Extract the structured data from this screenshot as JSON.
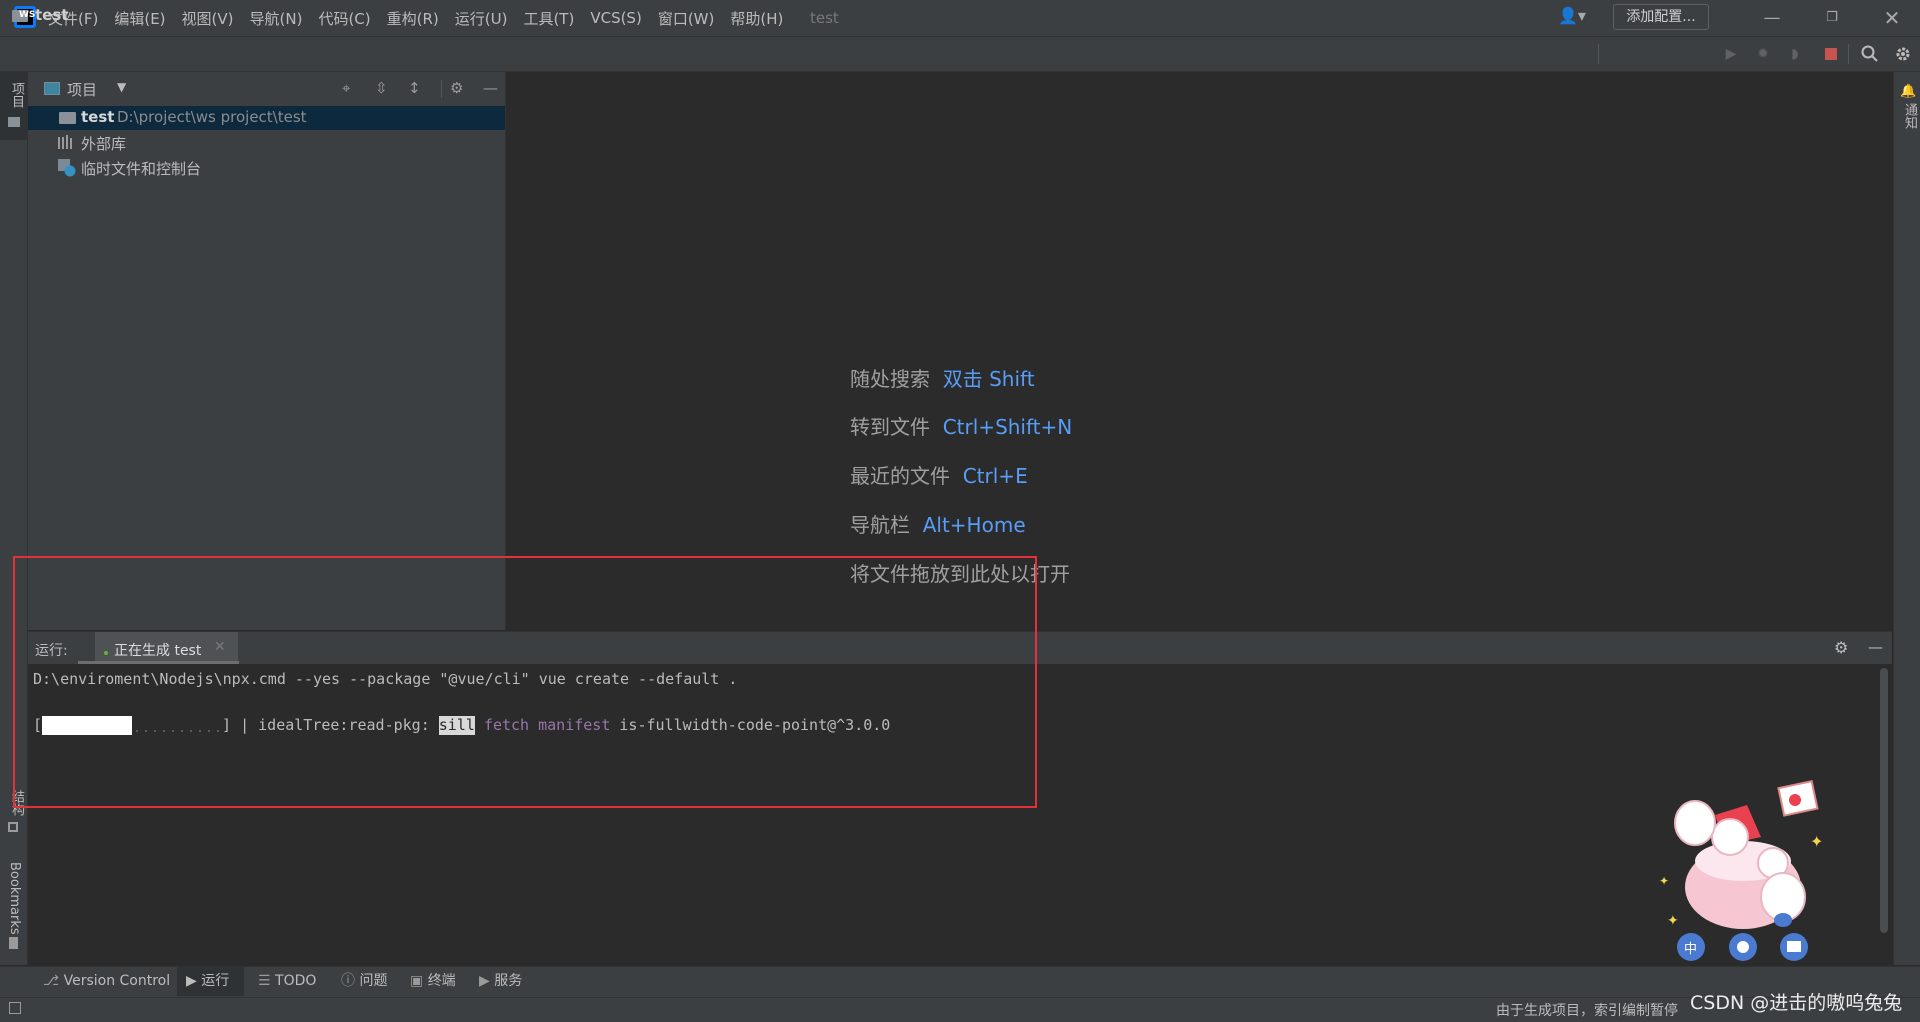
{
  "menubar": {
    "items": [
      "文件(F)",
      "编辑(E)",
      "视图(V)",
      "导航(N)",
      "代码(C)",
      "重构(R)",
      "运行(U)",
      "工具(T)",
      "VCS(S)",
      "窗口(W)",
      "帮助(H)"
    ],
    "window_title": "test"
  },
  "navbar": {
    "project": "test",
    "add_config": "添加配置..."
  },
  "left_stripe": {
    "project": "项目",
    "structure": "结构",
    "bookmarks": "Bookmarks"
  },
  "right_stripe": {
    "notifications": "通知"
  },
  "project_panel": {
    "title": "项目",
    "tree": {
      "root_name": "test",
      "root_path": "D:\\project\\ws project\\test",
      "external_libs": "外部库",
      "scratches": "临时文件和控制台"
    }
  },
  "editor": {
    "hints": [
      {
        "label": "随处搜索",
        "key": "双击 Shift"
      },
      {
        "label": "转到文件",
        "key": "Ctrl+Shift+N"
      },
      {
        "label": "最近的文件",
        "key": "Ctrl+E"
      },
      {
        "label": "导航栏",
        "key": "Alt+Home"
      },
      {
        "label": "将文件拖放到此处以打开",
        "key": ""
      }
    ]
  },
  "run_panel": {
    "label": "运行:",
    "tab": "正在生成 test",
    "console": {
      "line1": "D:\\enviroment\\Nodejs\\npx.cmd --yes --package \"@vue/cli\" vue create --default .",
      "progress_fraction": 0.5,
      "line2_prefix": "] | idealTree:read-pkg: ",
      "sill": "sill",
      "fetch_manifest": "fetch manifest",
      "line2_suffix": "is-fullwidth-code-point@^3.0.0"
    }
  },
  "bottom_toolbar": {
    "version_control": "Version Control",
    "run": "运行",
    "todo": "TODO",
    "problems": "问题",
    "terminal": "终端",
    "services": "服务"
  },
  "status": {
    "text": "由于生成项目，索引编制暂停",
    "watermark": "CSDN @进击的嗷呜兔兔"
  },
  "colors": {
    "accent_blue": "#589df6",
    "highlight_red": "#e2313a",
    "purple": "#9876aa",
    "green_dot": "#5fb832"
  }
}
